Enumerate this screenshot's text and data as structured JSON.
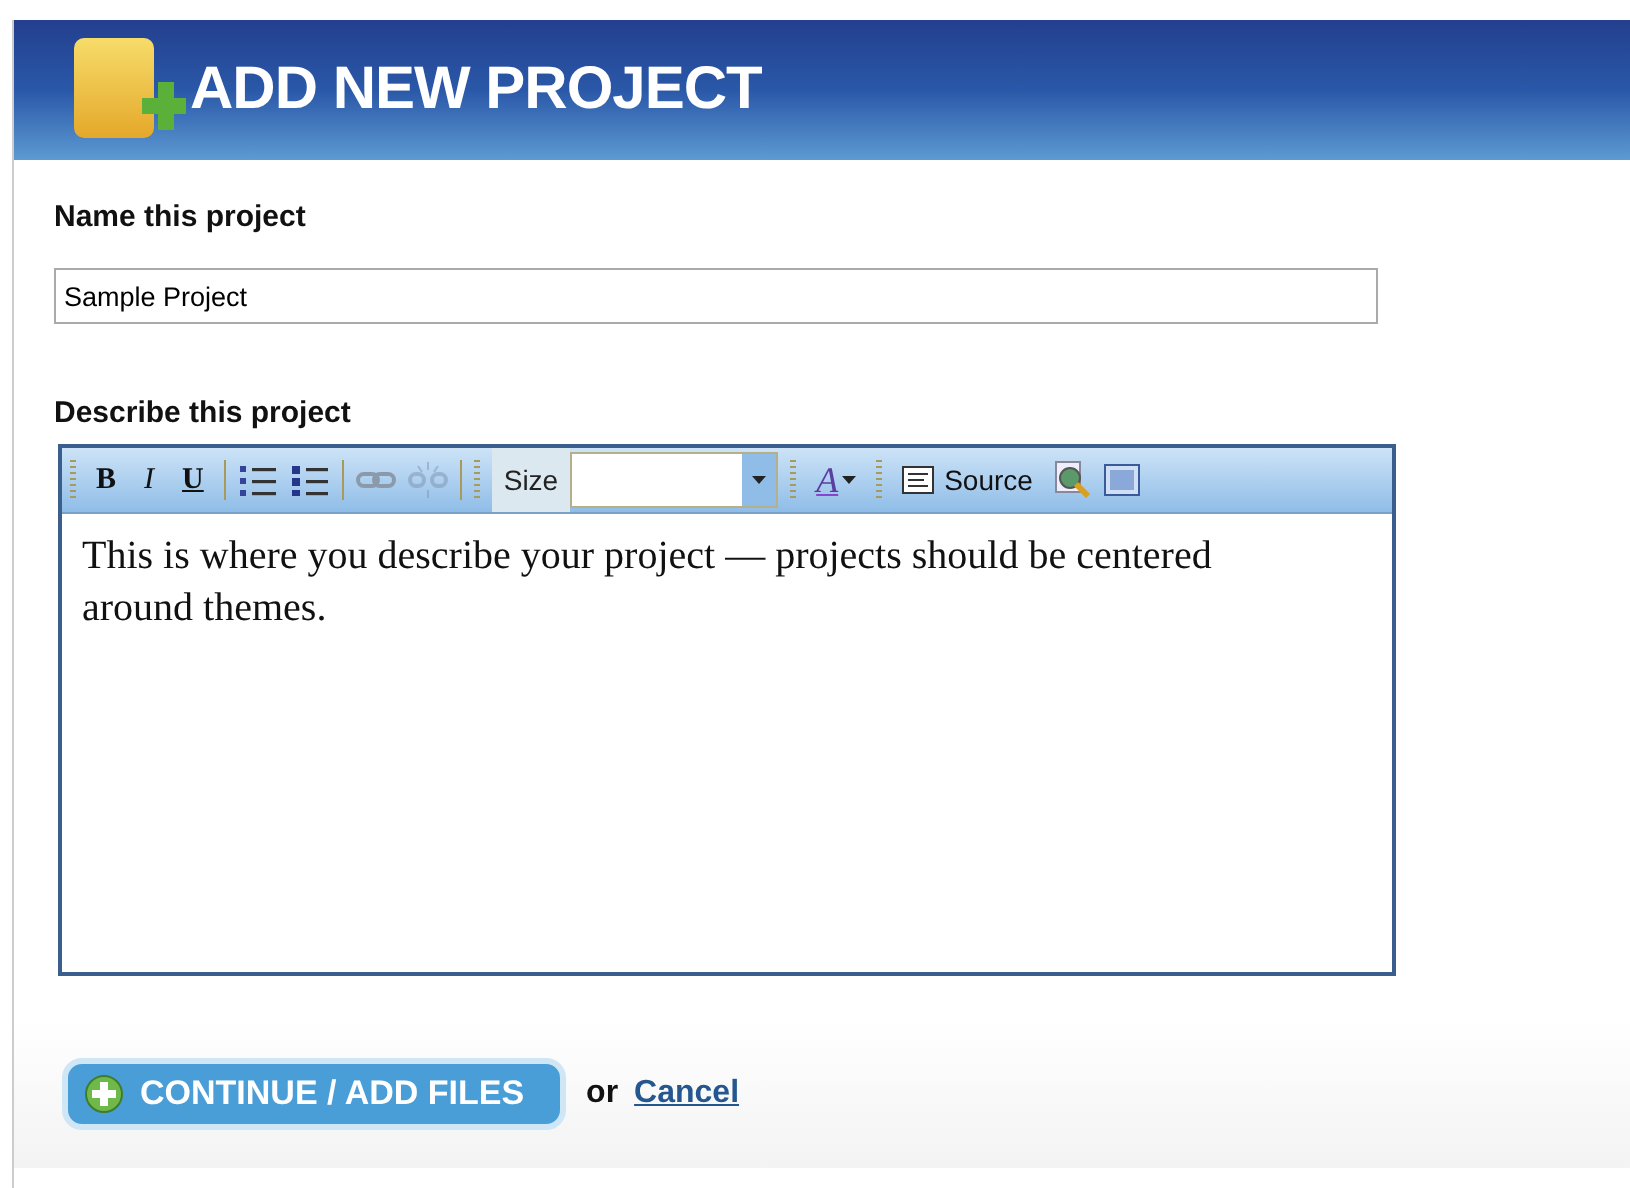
{
  "header": {
    "title": "ADD NEW PROJECT"
  },
  "name_field": {
    "label": "Name this project",
    "value": "Sample Project"
  },
  "description": {
    "label": "Describe this project",
    "toolbar": {
      "bold": "B",
      "italic": "I",
      "underline": "U",
      "size_label": "Size",
      "font_color": "A",
      "source": "Source",
      "unlink_disabled": true
    },
    "text": "This is where you describe your project — projects should be centered around themes."
  },
  "actions": {
    "primary": "CONTINUE / ADD FILES",
    "separator": "or",
    "cancel": "Cancel"
  }
}
